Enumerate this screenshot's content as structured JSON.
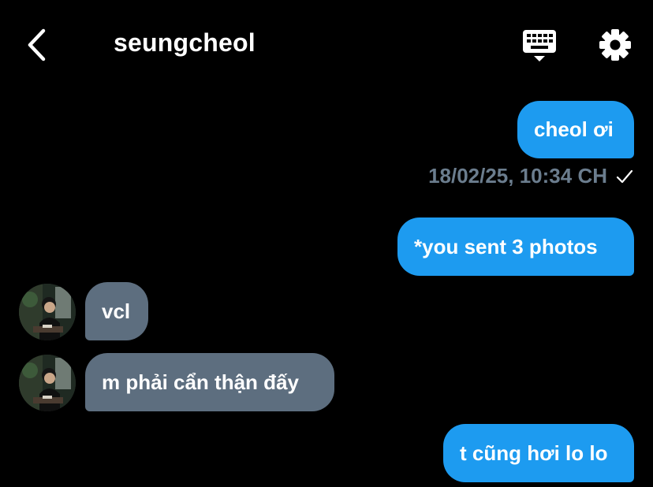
{
  "header": {
    "back_icon": "chevron-left-icon",
    "title": "seungcheol",
    "keyboard_icon": "keyboard-icon",
    "settings_icon": "gear-icon"
  },
  "messages": [
    {
      "direction": "sent",
      "text": "cheol ơi"
    },
    {
      "direction": "sent",
      "text": "*you sent 3 photos"
    },
    {
      "direction": "received",
      "text": "vcl"
    },
    {
      "direction": "received",
      "text": "m phải cẩn thận đấy"
    },
    {
      "direction": "sent",
      "text": "t cũng hơi lo lo"
    }
  ],
  "timestamp": {
    "text": "18/02/25, 10:34 CH",
    "status_icon": "check-icon"
  },
  "colors": {
    "background": "#000000",
    "sent_bubble": "#1d9bf0",
    "received_bubble": "#5d6e7f",
    "timestamp_text": "#6b7d8e",
    "text": "#ffffff"
  }
}
